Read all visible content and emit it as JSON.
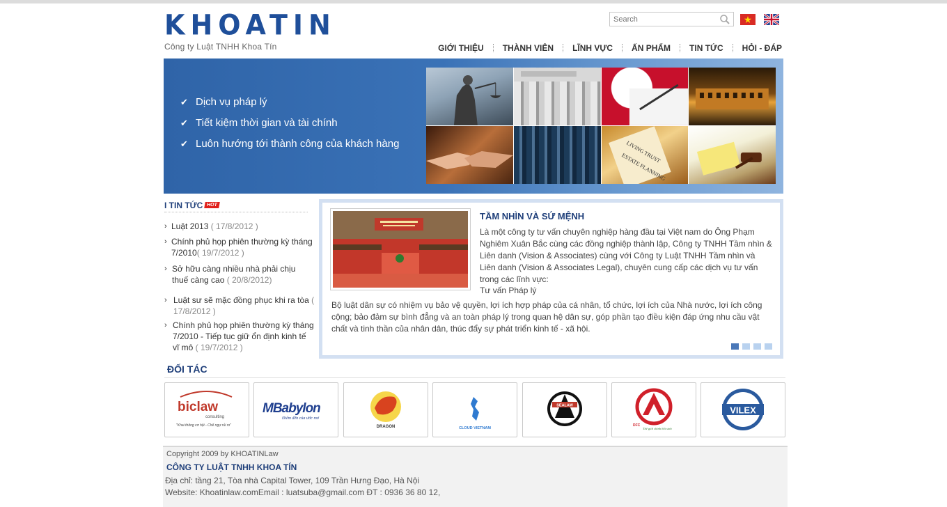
{
  "header": {
    "logo": "KHOATIN",
    "subtitle": "Công ty Luật TNHH Khoa Tín",
    "search_placeholder": "Search"
  },
  "nav": {
    "items": [
      {
        "label": "GIỚI THIỆU"
      },
      {
        "label": "THÀNH VIÊN"
      },
      {
        "label": "LĨNH VỰC"
      },
      {
        "label": "ẤN PHẨM"
      },
      {
        "label": "TIN TỨC"
      },
      {
        "label": "HỎI - ĐÁP"
      }
    ]
  },
  "banner": {
    "bullets": [
      "Dịch vụ pháp lý",
      "Tiết kiệm thời gian và tài chính",
      "Luôn hướng tới thành công của khách hàng"
    ]
  },
  "news": {
    "title": "I TIN TỨC",
    "badge": "HOT",
    "items": [
      {
        "title": "Luật 2013",
        "date": " ( 17/8/2012 )"
      },
      {
        "title": "Chính phủ họp phiên thường kỳ tháng 7/2010",
        "date": "( 19/7/2012 )"
      },
      {
        "title": "Sở hữu càng nhiều nhà phải chịu thuế càng cao",
        "date": " ( 20/8/2012)"
      },
      {
        "title": "Luật sư sẽ mặc đồng phục khi ra tòa",
        "date": " ( 17/8/2012 )"
      },
      {
        "title": "Chính phủ họp phiên thường kỳ tháng 7/2010 - Tiếp tục giữ ổn định kinh tế vĩ mô",
        "date": "  ( 19/7/2012 )"
      }
    ]
  },
  "feature": {
    "title": "TẦM NHÌN VÀ SỨ MỆNH",
    "body": "Là một công ty tư vấn chuyên nghiệp hàng đầu tại Việt nam do Ông Phạm Nghiêm Xuân Bắc cùng các đồng nghiệp thành lập, Công ty TNHH Tầm nhìn & Liên danh (Vision & Associates) cùng với Công ty Luật TNHH Tầm nhìn và Liên danh (Vision & Associates Legal), chuyên cung cấp các dịch vụ tư vấn trong các lĩnh vực:",
    "sub": "Tư vấn Pháp lý",
    "paragraph": "Bộ luật dân sự có nhiệm vụ bảo vệ quyền, lợi ích hợp pháp của cá nhân, tổ chức, lợi ích của Nhà nước, lợi ích công cộng; bảo đảm sự bình đẳng và an toàn pháp lý trong quan hệ dân sự, góp phần tạo điều kiện đáp ứng nhu cầu vật chất và tinh thần của nhân dân, thúc đẩy sự phát triển kinh tế - xã hội.",
    "slides": 4,
    "active_slide": 1
  },
  "partners": {
    "title": "ĐỐI TÁC",
    "logos": [
      {
        "name": "biclaw-logo",
        "text": "biclaw",
        "sub": "consulting",
        "tagline": "\"Khai thông cơ hội - Chế ngự rủi ro\""
      },
      {
        "name": "mbabylon-logo",
        "text": "MBabylon",
        "tagline": "Điểm đến của ước mơ"
      },
      {
        "name": "dragon-logo",
        "text": "DRAGON"
      },
      {
        "name": "cloud-vietnam-logo",
        "text": "CLOUD VIETNAM"
      },
      {
        "name": "sealaw-logo",
        "text": "SEALAW"
      },
      {
        "name": "dfc-logo",
        "text": "DFC",
        "tagline": "Thế giới chinh hồi sinh"
      },
      {
        "name": "vilex-logo",
        "text": "VILEX"
      }
    ]
  },
  "footer": {
    "copyright": "Copyright 2009 by KHOATINLaw",
    "company": "CÔNG TY LUẬT TNHH KHOA TÍN",
    "address": "Địa chỉ: tầng 21, Tòa nhà Capital Tower, 109 Trần Hưng Đạo, Hà Nội",
    "contact": "Website: Khoatinlaw.comEmail : luatsuba@gmail.com ĐT : 0936 36 80 12,"
  }
}
